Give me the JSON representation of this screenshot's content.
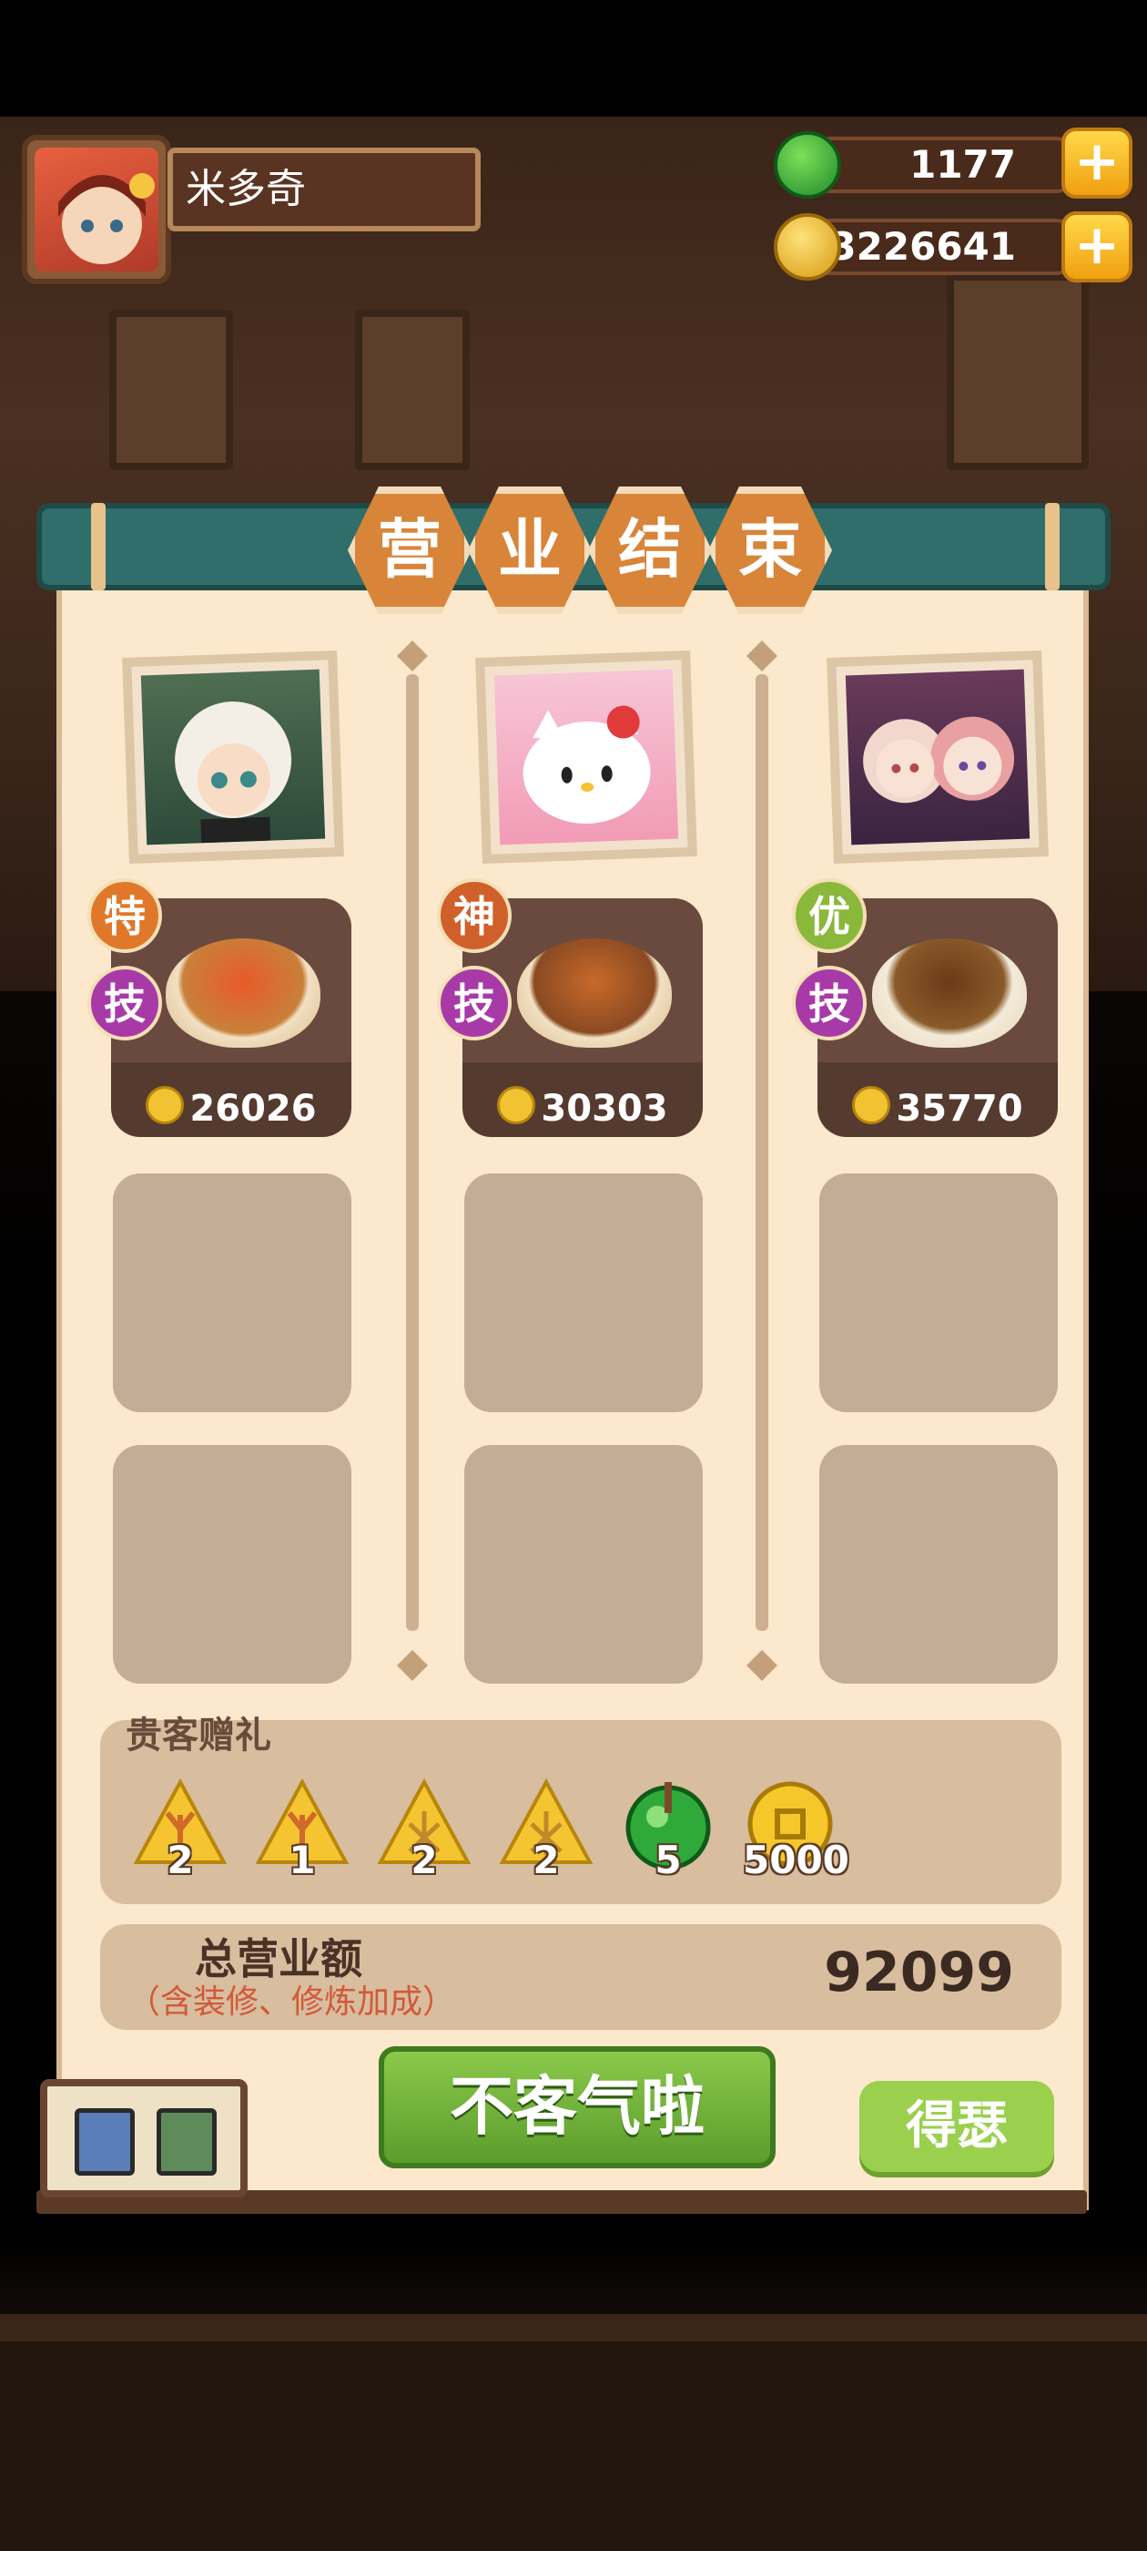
{
  "player": {
    "name": "米多奇"
  },
  "resources": {
    "jade": {
      "icon": "jade-coin-icon",
      "value": "1177"
    },
    "gold": {
      "icon": "gold-coin-icon",
      "value": "3226641"
    }
  },
  "title_chars": [
    "营",
    "业",
    "结",
    "束"
  ],
  "columns": [
    {
      "portrait": "white-hair-chef-portrait",
      "grade": "特",
      "skill": "技",
      "grade_color": "#e0782a",
      "dish_value": "26026"
    },
    {
      "portrait": "hello-kitty-portrait",
      "grade": "神",
      "skill": "技",
      "grade_color": "#d0602a",
      "dish_value": "30303"
    },
    {
      "portrait": "twin-girls-portrait",
      "grade": "优",
      "skill": "技",
      "grade_color": "#8ab83a",
      "dish_value": "35770"
    }
  ],
  "gifts": {
    "label": "贵客赠礼",
    "items": [
      {
        "icon": "coral-ingredient-icon",
        "count": "2"
      },
      {
        "icon": "coral-ingredient-icon",
        "count": "1"
      },
      {
        "icon": "lattice-ingredient-icon",
        "count": "2"
      },
      {
        "icon": "lattice-ingredient-icon",
        "count": "2"
      },
      {
        "icon": "jade-coin-icon",
        "count": "5"
      },
      {
        "icon": "gold-coin-icon",
        "count": "5000"
      }
    ]
  },
  "total": {
    "label": "总营业额",
    "note": "（含装修、修炼加成）",
    "value": "92099"
  },
  "buttons": {
    "main": "不客气啦",
    "side": "得瑟"
  }
}
